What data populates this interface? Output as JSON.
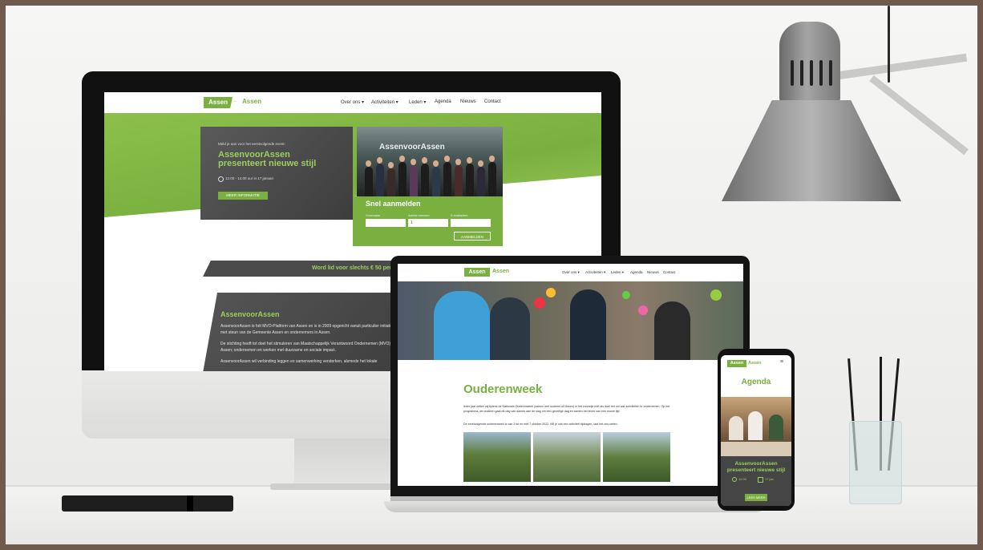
{
  "desktop_site": {
    "logo_a": "Assen",
    "logo_sep": "..",
    "logo_b": "Assen",
    "nav": [
      "Over ons ▾",
      "Activiteiten ▾",
      "Leden ▾",
      "Agenda",
      "Nieuws",
      "Contact"
    ],
    "hero_kicker": "Meld je aan voor het eerstvolgende event:",
    "hero_title_1": "AssenvoorAssen",
    "hero_title_2": "presenteert nieuwe stijl",
    "hero_time": "12.00 - 14.00 uur in 17 januari",
    "hero_button": "MEER INFORMATIE",
    "photo_banner": "AssenvoorAssen",
    "signup_title": "Snel aanmelden",
    "signup_fields": [
      "Voornaam",
      "Aantal mensen",
      "E-mailadres"
    ],
    "signup_qty": "1",
    "signup_button": "AANMELDEN",
    "promo_bar": "Word lid voor slechts € 50 per jaar",
    "about_title": "AssenvoorAssen",
    "about_p1": "AssenvoorAssen is hét MVO-Platform van Assen en is in 2009 opgericht vanuit particulier initiatief met steun van de Gemeente Assen en ondernemers in Assen.",
    "about_p2": "De stichting heeft tot doel het stimuleren van Maatschappelijk Verantwoord Ondernemen (MVO) in Assen; ondernemen en werken met duurzame en sociale impact.",
    "about_p3": "AssenvoorAssen wil verbinding leggen en samenwerking versterken, alsmede het lokale"
  },
  "laptop_site": {
    "logo_a": "Assen",
    "logo_b": "Assen",
    "nav": [
      "Over ons ▾",
      "Activiteiten ▾",
      "Leden ▾",
      "Agenda",
      "Nieuws",
      "Contact"
    ],
    "page_title": "Ouderenweek",
    "body_1": "Ieder jaar zetten wij tijdens de Nationale Ouderenweek (samen met ouderen uit Assen) in het zonnetje met als doel het om wat activiteiten te ondernemen. Op het programma, de ouderen gaat de dag van samen aan de slag om een gezellige dag en samen het leven van een mooie tijd.",
    "body_2": "De eerstvolgende ouderenweek is van 3 tot en met 7 oktober 2022. Wil je ook een activiteit bijdragen, laat het ons weten."
  },
  "phone_site": {
    "logo_a": "Assen",
    "logo_b": "Assen",
    "menu_icon": "≡",
    "title": "Agenda",
    "event_title_1": "AssenvoorAssen",
    "event_title_2": "presenteert nieuwe stijl",
    "event_time": "12.00",
    "event_date": "17 jan",
    "event_button": "LEES MEER"
  },
  "colors": {
    "brand_green": "#7ab040",
    "light_green": "#9ccf5c",
    "dark_card": "#444444",
    "frame": "#6f5a4d"
  }
}
